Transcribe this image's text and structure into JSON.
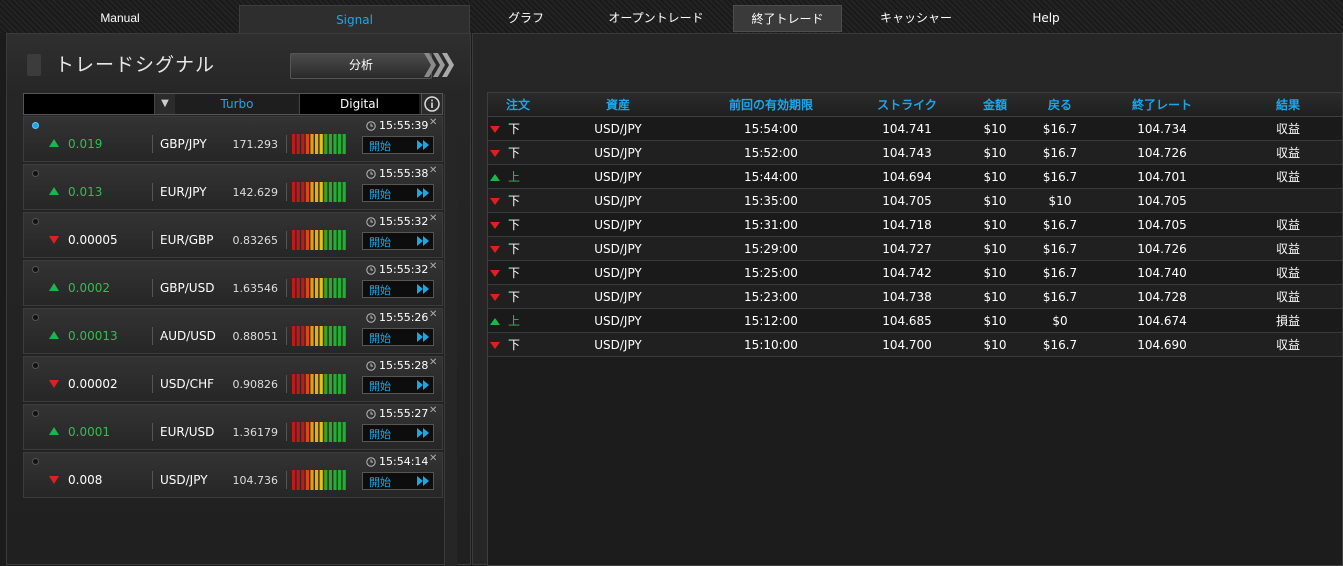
{
  "nav": {
    "manual": "Manual",
    "signal": "Signal",
    "graph": "グラフ",
    "open_trades": "オープントレード",
    "closed_trades": "終了トレード",
    "cashier": "キャッシャー",
    "help": "Help"
  },
  "left": {
    "title": "トレードシグナル",
    "analyze": "分析",
    "filter_turbo": "Turbo",
    "filter_digital": "Digital",
    "start_label": "開始"
  },
  "colors": {
    "accent": "#1ba6e8",
    "up": "#22b24c",
    "down": "#e02020"
  },
  "signals": [
    {
      "direction": "up",
      "value": "0.019",
      "pair": "GBP/JPY",
      "price": "171.293",
      "time": "15:55:39",
      "live": true
    },
    {
      "direction": "up",
      "value": "0.013",
      "pair": "EUR/JPY",
      "price": "142.629",
      "time": "15:55:38",
      "live": false
    },
    {
      "direction": "down",
      "value": "0.00005",
      "pair": "EUR/GBP",
      "price": "0.83265",
      "time": "15:55:32",
      "live": false
    },
    {
      "direction": "up",
      "value": "0.0002",
      "pair": "GBP/USD",
      "price": "1.63546",
      "time": "15:55:32",
      "live": false
    },
    {
      "direction": "up",
      "value": "0.00013",
      "pair": "AUD/USD",
      "price": "0.88051",
      "time": "15:55:26",
      "live": false
    },
    {
      "direction": "down",
      "value": "0.00002",
      "pair": "USD/CHF",
      "price": "0.90826",
      "time": "15:55:28",
      "live": false
    },
    {
      "direction": "up",
      "value": "0.0001",
      "pair": "EUR/USD",
      "price": "1.36179",
      "time": "15:55:27",
      "live": false
    },
    {
      "direction": "down",
      "value": "0.008",
      "pair": "USD/JPY",
      "price": "104.736",
      "time": "15:54:14",
      "live": false
    }
  ],
  "trades": {
    "headers": [
      "注文",
      "資産",
      "前回の有効期限",
      "ストライク",
      "金額",
      "戻る",
      "終了レート",
      "結果"
    ],
    "rows": [
      {
        "direction": "down",
        "order": "下",
        "asset": "USD/JPY",
        "expiry": "15:54:00",
        "strike": "104.741",
        "amount": "$10",
        "return": "$16.7",
        "close": "104.734",
        "result": "収益"
      },
      {
        "direction": "down",
        "order": "下",
        "asset": "USD/JPY",
        "expiry": "15:52:00",
        "strike": "104.743",
        "amount": "$10",
        "return": "$16.7",
        "close": "104.726",
        "result": "収益"
      },
      {
        "direction": "up",
        "order": "上",
        "asset": "USD/JPY",
        "expiry": "15:44:00",
        "strike": "104.694",
        "amount": "$10",
        "return": "$16.7",
        "close": "104.701",
        "result": "収益"
      },
      {
        "direction": "down",
        "order": "下",
        "asset": "USD/JPY",
        "expiry": "15:35:00",
        "strike": "104.705",
        "amount": "$10",
        "return": "$10",
        "close": "104.705",
        "result": ""
      },
      {
        "direction": "down",
        "order": "下",
        "asset": "USD/JPY",
        "expiry": "15:31:00",
        "strike": "104.718",
        "amount": "$10",
        "return": "$16.7",
        "close": "104.705",
        "result": "収益"
      },
      {
        "direction": "down",
        "order": "下",
        "asset": "USD/JPY",
        "expiry": "15:29:00",
        "strike": "104.727",
        "amount": "$10",
        "return": "$16.7",
        "close": "104.726",
        "result": "収益"
      },
      {
        "direction": "down",
        "order": "下",
        "asset": "USD/JPY",
        "expiry": "15:25:00",
        "strike": "104.742",
        "amount": "$10",
        "return": "$16.7",
        "close": "104.740",
        "result": "収益"
      },
      {
        "direction": "down",
        "order": "下",
        "asset": "USD/JPY",
        "expiry": "15:23:00",
        "strike": "104.738",
        "amount": "$10",
        "return": "$16.7",
        "close": "104.728",
        "result": "収益"
      },
      {
        "direction": "up",
        "order": "上",
        "asset": "USD/JPY",
        "expiry": "15:12:00",
        "strike": "104.685",
        "amount": "$10",
        "return": "$0",
        "close": "104.674",
        "result": "損益"
      },
      {
        "direction": "down",
        "order": "下",
        "asset": "USD/JPY",
        "expiry": "15:10:00",
        "strike": "104.700",
        "amount": "$10",
        "return": "$16.7",
        "close": "104.690",
        "result": "収益"
      }
    ]
  }
}
